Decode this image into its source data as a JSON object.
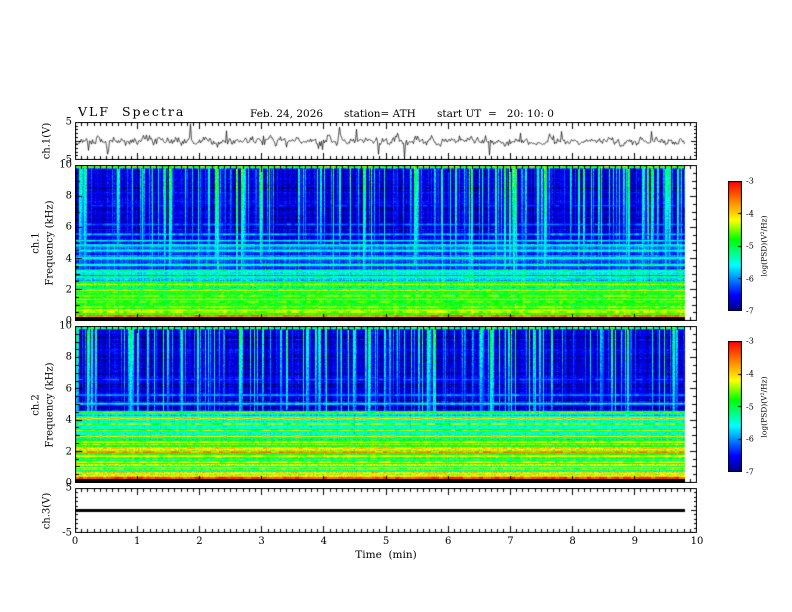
{
  "header": {
    "title": "VLF  Spectra",
    "date": "Feb. 24, 2026",
    "station": "station= ATH",
    "start_ut": "start UT  =   20: 10: 0"
  },
  "colors": {
    "background": "#ffffff",
    "foreground": "#000000"
  },
  "x_axis": {
    "label": "Time  (min)",
    "min": 0,
    "max": 10,
    "tick_labels": [
      "0",
      "1",
      "2",
      "3",
      "4",
      "5",
      "6",
      "7",
      "8",
      "9",
      "10"
    ],
    "minor_tick_step_min": 0.1,
    "data_end_min": 9.8
  },
  "panels": {
    "ch1_voltage": {
      "ylabel": "ch.1(V)",
      "ymin": -5,
      "ymax": 5,
      "ytick_labels": [
        "5",
        "-5"
      ],
      "ytick_values": [
        5,
        -5
      ]
    },
    "ch1_spec": {
      "ylabel_channel": "ch.1",
      "ylabel_axis": "Frequency  (kHz)",
      "ymin": 0,
      "ymax": 10,
      "ytick_labels": [
        "10",
        "8",
        "6",
        "4",
        "2",
        "0"
      ],
      "ytick_values": [
        10,
        8,
        6,
        4,
        2,
        0
      ]
    },
    "ch2_spec": {
      "ylabel_channel": "ch.2",
      "ylabel_axis": "Frequency  (kHz)",
      "ymin": 0,
      "ymax": 10,
      "ytick_labels": [
        "10",
        "8",
        "6",
        "4",
        "2",
        "0"
      ],
      "ytick_values": [
        10,
        8,
        6,
        4,
        2,
        0
      ]
    },
    "ch3_voltage": {
      "ylabel": "ch.3(V)",
      "ymin": -5,
      "ymax": 5,
      "ytick_labels": [
        "5",
        "-5"
      ],
      "ytick_values": [
        5,
        -5
      ]
    }
  },
  "colorbar": {
    "label": "log(PSD)(V²/Hz)",
    "tick_labels": [
      "-3",
      "-4",
      "-5",
      "-6",
      "-7"
    ],
    "tick_values": [
      -3,
      -4,
      -5,
      -6,
      -7
    ],
    "vmin": -7,
    "vmax": -3,
    "colormap": "jet",
    "gradient": [
      {
        "t": 0.0,
        "rgb": [
          0,
          0,
          135
        ]
      },
      {
        "t": 0.12,
        "rgb": [
          0,
          0,
          255
        ]
      },
      {
        "t": 0.35,
        "rgb": [
          0,
          255,
          255
        ]
      },
      {
        "t": 0.55,
        "rgb": [
          0,
          255,
          0
        ]
      },
      {
        "t": 0.7,
        "rgb": [
          255,
          255,
          0
        ]
      },
      {
        "t": 0.85,
        "rgb": [
          255,
          130,
          0
        ]
      },
      {
        "t": 1.0,
        "rgb": [
          255,
          0,
          0
        ]
      }
    ]
  },
  "chart_data": [
    {
      "type": "line",
      "name": "ch1_waveform",
      "xlabel": "Time (min)",
      "ylabel": "ch.1(V)",
      "xlim": [
        0,
        10
      ],
      "ylim": [
        -5,
        5
      ],
      "data_end_min": 9.8,
      "signal": {
        "description": "broadband noise ~±1 V with impulsive spikes reaching ±4 V",
        "noise_V": 0.75,
        "spike_rate": 0.05,
        "spike_V_max": 4.0,
        "seed": 11
      }
    },
    {
      "type": "heatmap",
      "name": "ch1_spectrogram",
      "xlabel": "Time (min)",
      "ylabel": "ch.1 Frequency (kHz)",
      "xlim": [
        0,
        10
      ],
      "ylim": [
        0,
        10
      ],
      "zlim": [
        -7,
        -3
      ],
      "zlabel": "log(PSD)(V²/Hz)",
      "colormap": "jet",
      "seed": 31,
      "description": "dark-blue background above ~5 kHz crossed by dense vertical sferic streaks; cyan horizontal lines 3-5 kHz; bright green band below ~2.5 kHz; red line near 0.3 kHz; black band below 0.2 kHz",
      "bands": [
        {
          "f0": 0.0,
          "f1": 0.2,
          "level": -7.3
        },
        {
          "f0": 0.2,
          "f1": 1.0,
          "level": -4.8
        },
        {
          "f0": 1.0,
          "f1": 2.5,
          "level": -5.0
        },
        {
          "f0": 2.5,
          "f1": 3.2,
          "level": -5.7
        },
        {
          "f0": 3.2,
          "f1": 4.8,
          "level": -6.25
        },
        {
          "f0": 4.8,
          "f1": 10.01,
          "level": -6.7
        }
      ],
      "hlines": [
        {
          "f": 0.3,
          "level": -3.4,
          "w": 0.06
        },
        {
          "f": 0.55,
          "level": -4.35,
          "w": 0.05
        },
        {
          "f": 0.85,
          "level": -4.5,
          "w": 0.05
        },
        {
          "f": 1.2,
          "level": -4.55,
          "w": 0.05
        },
        {
          "f": 1.6,
          "level": -4.5,
          "w": 0.05
        },
        {
          "f": 2.0,
          "level": -4.7,
          "w": 0.05
        },
        {
          "f": 2.35,
          "level": -4.9,
          "w": 0.05
        },
        {
          "f": 2.8,
          "level": -5.15,
          "w": 0.05
        },
        {
          "f": 3.2,
          "level": -5.1,
          "w": 0.05
        },
        {
          "f": 3.6,
          "level": -5.3,
          "w": 0.05
        },
        {
          "f": 4.05,
          "level": -5.2,
          "w": 0.06
        },
        {
          "f": 4.5,
          "level": -5.4,
          "w": 0.05
        },
        {
          "f": 4.85,
          "level": -5.1,
          "w": 0.05
        },
        {
          "f": 5.15,
          "level": -5.5,
          "w": 0.05
        },
        {
          "f": 5.55,
          "level": -5.9,
          "w": 0.05
        },
        {
          "f": 6.2,
          "level": -6.2,
          "w": 0.05
        },
        {
          "f": 7.4,
          "level": -6.45,
          "w": 0.05
        },
        {
          "f": 9.95,
          "level": -4.5,
          "w": 0.08
        }
      ],
      "streaks": {
        "density": 0.45,
        "max_boost": 2.6,
        "min_freq": 2.0,
        "fmax_extra": 2.5,
        "seed": 101
      }
    },
    {
      "type": "heatmap",
      "name": "ch2_spectrogram",
      "xlabel": "Time (min)",
      "ylabel": "ch.2 Frequency (kHz)",
      "xlim": [
        0,
        10
      ],
      "ylim": [
        0,
        10
      ],
      "zlim": [
        -7,
        -3
      ],
      "zlabel": "log(PSD)(V²/Hz)",
      "colormap": "jet",
      "seed": 41,
      "description": "like ch.1 but hotter: orange/red horizontal lines near 2 kHz and 3-4.5 kHz, yellow-green band below 2.6 kHz, red line near 0.3 kHz, black band below 0.2 kHz",
      "bands": [
        {
          "f0": 0.0,
          "f1": 0.2,
          "level": -7.3
        },
        {
          "f0": 0.2,
          "f1": 1.0,
          "level": -4.6
        },
        {
          "f0": 1.0,
          "f1": 2.6,
          "level": -4.8
        },
        {
          "f0": 2.6,
          "f1": 4.6,
          "level": -5.55
        },
        {
          "f0": 4.6,
          "f1": 10.01,
          "level": -6.7
        }
      ],
      "hlines": [
        {
          "f": 0.3,
          "level": -3.2,
          "w": 0.07
        },
        {
          "f": 0.6,
          "level": -4.1,
          "w": 0.05
        },
        {
          "f": 0.95,
          "level": -4.2,
          "w": 0.05
        },
        {
          "f": 1.3,
          "level": -4.3,
          "w": 0.05
        },
        {
          "f": 1.7,
          "level": -4.1,
          "w": 0.05
        },
        {
          "f": 1.95,
          "level": -3.6,
          "w": 0.06
        },
        {
          "f": 2.2,
          "level": -3.9,
          "w": 0.05
        },
        {
          "f": 2.6,
          "level": -4.3,
          "w": 0.05
        },
        {
          "f": 2.95,
          "level": -4.1,
          "w": 0.06
        },
        {
          "f": 3.35,
          "level": -4.4,
          "w": 0.05
        },
        {
          "f": 3.75,
          "level": -4.3,
          "w": 0.05
        },
        {
          "f": 4.1,
          "level": -3.9,
          "w": 0.06
        },
        {
          "f": 4.5,
          "level": -4.6,
          "w": 0.05
        },
        {
          "f": 5.05,
          "level": -5.5,
          "w": 0.05
        },
        {
          "f": 5.6,
          "level": -6.0,
          "w": 0.05
        },
        {
          "f": 6.6,
          "level": -6.3,
          "w": 0.05
        },
        {
          "f": 9.95,
          "level": -4.5,
          "w": 0.08
        }
      ],
      "streaks": {
        "density": 0.4,
        "max_boost": 2.5,
        "min_freq": 2.2,
        "fmax_extra": 2.5,
        "seed": 202
      }
    },
    {
      "type": "line",
      "name": "ch3_waveform",
      "xlabel": "Time (min)",
      "ylabel": "ch.3(V)",
      "xlim": [
        0,
        10
      ],
      "ylim": [
        -5,
        5
      ],
      "data_end_min": 9.8,
      "signal": {
        "description": "flat thick line at 0 V for entire record",
        "constant_V": 0,
        "seed": 0
      }
    }
  ]
}
